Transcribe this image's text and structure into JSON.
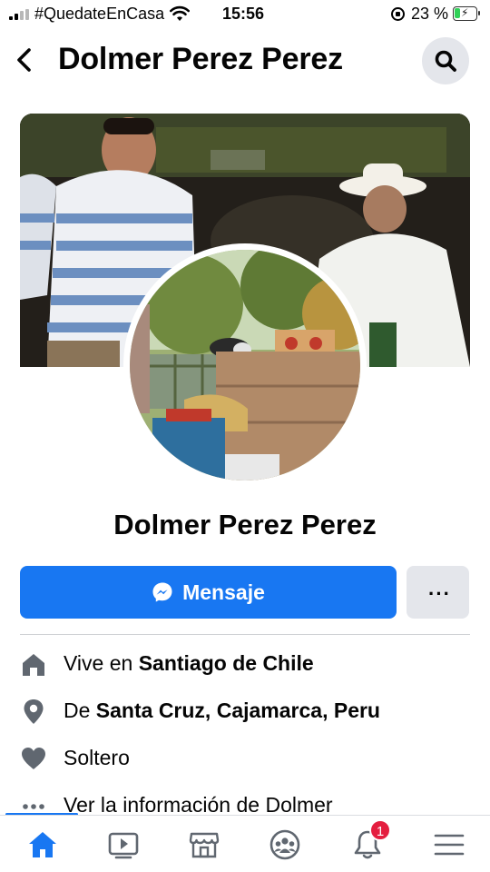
{
  "status_bar": {
    "carrier": "#QuedateEnCasa",
    "time": "15:56",
    "battery_percent": "23 %",
    "battery_level": 0.23
  },
  "header": {
    "title": "Dolmer Perez Perez",
    "back_icon": "chevron-left-icon",
    "search_icon": "search-icon"
  },
  "profile": {
    "name": "Dolmer Perez Perez"
  },
  "actions": {
    "message_label": "Mensaje",
    "message_icon": "messenger-icon",
    "more_label": "···",
    "primary_color": "#1877f2"
  },
  "info": {
    "lives_prefix": "Vive en ",
    "lives_city": "Santiago de Chile",
    "from_prefix": "De ",
    "from_place": "Santa Cruz, Cajamarca, Peru",
    "relationship": "Soltero",
    "see_info": "Ver la información de Dolmer"
  },
  "bottom_nav": {
    "items": [
      "home-icon",
      "watch-icon",
      "marketplace-icon",
      "groups-icon",
      "notifications-icon",
      "menu-icon"
    ],
    "notification_count": "1",
    "active": "home-icon"
  }
}
